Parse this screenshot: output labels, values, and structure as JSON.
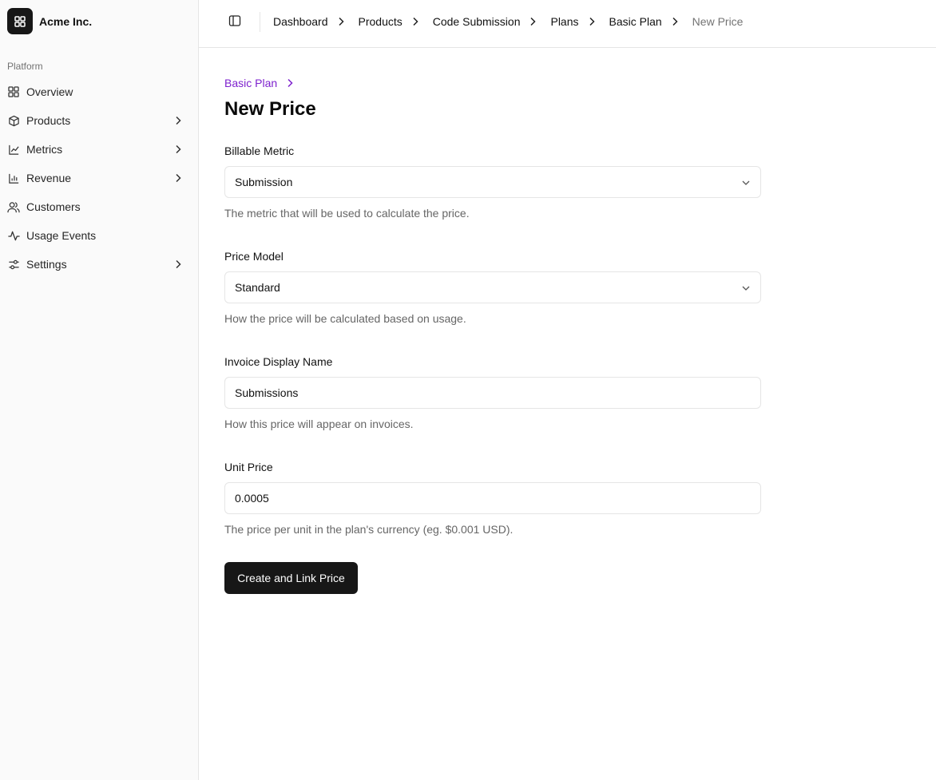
{
  "app": {
    "name": "Acme Inc."
  },
  "sidebar": {
    "group_label": "Platform",
    "items": [
      {
        "label": "Overview",
        "icon": "grid-icon",
        "has_chevron": false
      },
      {
        "label": "Products",
        "icon": "box-icon",
        "has_chevron": true
      },
      {
        "label": "Metrics",
        "icon": "line-chart-icon",
        "has_chevron": true
      },
      {
        "label": "Revenue",
        "icon": "bar-chart-icon",
        "has_chevron": true
      },
      {
        "label": "Customers",
        "icon": "users-icon",
        "has_chevron": false
      },
      {
        "label": "Usage Events",
        "icon": "activity-icon",
        "has_chevron": false
      },
      {
        "label": "Settings",
        "icon": "sliders-icon",
        "has_chevron": true
      }
    ]
  },
  "header": {
    "breadcrumbs": [
      "Dashboard",
      "Products",
      "Code Submission",
      "Plans",
      "Basic Plan"
    ],
    "current": "New Price"
  },
  "page": {
    "back_link": "Basic Plan",
    "title": "New Price"
  },
  "form": {
    "billable_metric": {
      "label": "Billable Metric",
      "value": "Submission",
      "help": "The metric that will be used to calculate the price."
    },
    "price_model": {
      "label": "Price Model",
      "value": "Standard",
      "help": "How the price will be calculated based on usage."
    },
    "invoice_display_name": {
      "label": "Invoice Display Name",
      "value": "Submissions",
      "help": "How this price will appear on invoices."
    },
    "unit_price": {
      "label": "Unit Price",
      "value": "0.0005",
      "help": "The price per unit in the plan's currency (eg. $0.001 USD)."
    },
    "submit_label": "Create and Link Price"
  },
  "colors": {
    "accent_link": "#7e22ce",
    "primary_button": "#171717",
    "sidebar_bg": "#fafafa"
  }
}
